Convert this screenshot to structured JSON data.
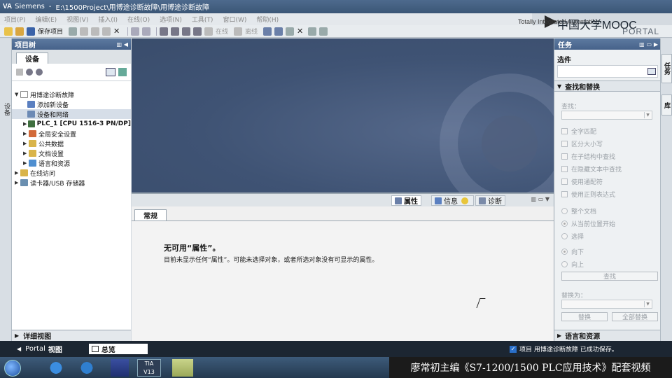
{
  "window": {
    "app_name": "Siemens",
    "separator": "-",
    "path": "E:\\1500Project\\用博途诊断故障\\用博途诊断故障"
  },
  "brand": {
    "mooc": "中国大学MOOC",
    "tia": "Totally Integrated Automation",
    "portal": "PORTAL"
  },
  "menu": [
    "项目(P)",
    "编辑(E)",
    "视图(V)",
    "插入(I)",
    "在线(O)",
    "选项(N)",
    "工具(T)",
    "窗口(W)",
    "帮助(H)"
  ],
  "toolbar": {
    "save_project": "保存项目",
    "online": "在线",
    "offline": "离线"
  },
  "project_tree": {
    "title": "项目树",
    "tab": "设备",
    "items": [
      {
        "label": "用博途诊断故障",
        "level": 0,
        "expanded": true
      },
      {
        "label": "添加新设备",
        "level": 1,
        "expandable": false
      },
      {
        "label": "设备和网络",
        "level": 1,
        "expandable": false,
        "selected": true
      },
      {
        "label": "PLC_1 [CPU 1516-3 PN/DP]",
        "level": 1,
        "expandable": true
      },
      {
        "label": "全局安全设置",
        "level": 1,
        "expandable": true
      },
      {
        "label": "公共数据",
        "level": 1,
        "expandable": true
      },
      {
        "label": "文档设置",
        "level": 1,
        "expandable": true
      },
      {
        "label": "语言和资源",
        "level": 1,
        "expandable": true
      },
      {
        "label": "在线访问",
        "level": 0,
        "expandable": true
      },
      {
        "label": "读卡器/USB 存储器",
        "level": 0,
        "expandable": true
      }
    ],
    "details_view": "详细视图"
  },
  "left_strip": {
    "label": "设备"
  },
  "inspector": {
    "tabs": {
      "properties": "属性",
      "info": "信息",
      "diagnostics": "诊断"
    },
    "general_tab": "常规",
    "title": "无可用“属性”。",
    "message": "目前未显示任何“属性”。可能未选择对象，或者所选对象没有可显示的属性。"
  },
  "tasks": {
    "title": "任务",
    "options": "选件",
    "find_replace": {
      "header": "查找和替换",
      "find_label": "查找：",
      "checkboxes": [
        "全字匹配",
        "区分大小写",
        "在子结构中查找",
        "在隐藏文本中查找",
        "使用通配符",
        "使用正则表达式"
      ],
      "scope": [
        "整个文档",
        "从当前位置开始",
        "选择"
      ],
      "direction": [
        "向下",
        "向上"
      ],
      "find_button": "查找",
      "replace_label": "替换为：",
      "replace_button": "替换",
      "replace_all_button": "全部替换"
    },
    "languages": "语言和资源"
  },
  "right_tabs": [
    "任务",
    "库"
  ],
  "statusbar": {
    "portal": "Portal",
    "view": "视图",
    "overview": "总览",
    "save_message": "项目 用博途诊断故障 已成功保存。"
  },
  "caption": "廖常初主编《S7-1200/1500 PLC应用技术》配套视频",
  "colors": {
    "header_blue": "#4d6a8d",
    "work_area": "#3f5374",
    "status_bar": "#1c2632"
  }
}
